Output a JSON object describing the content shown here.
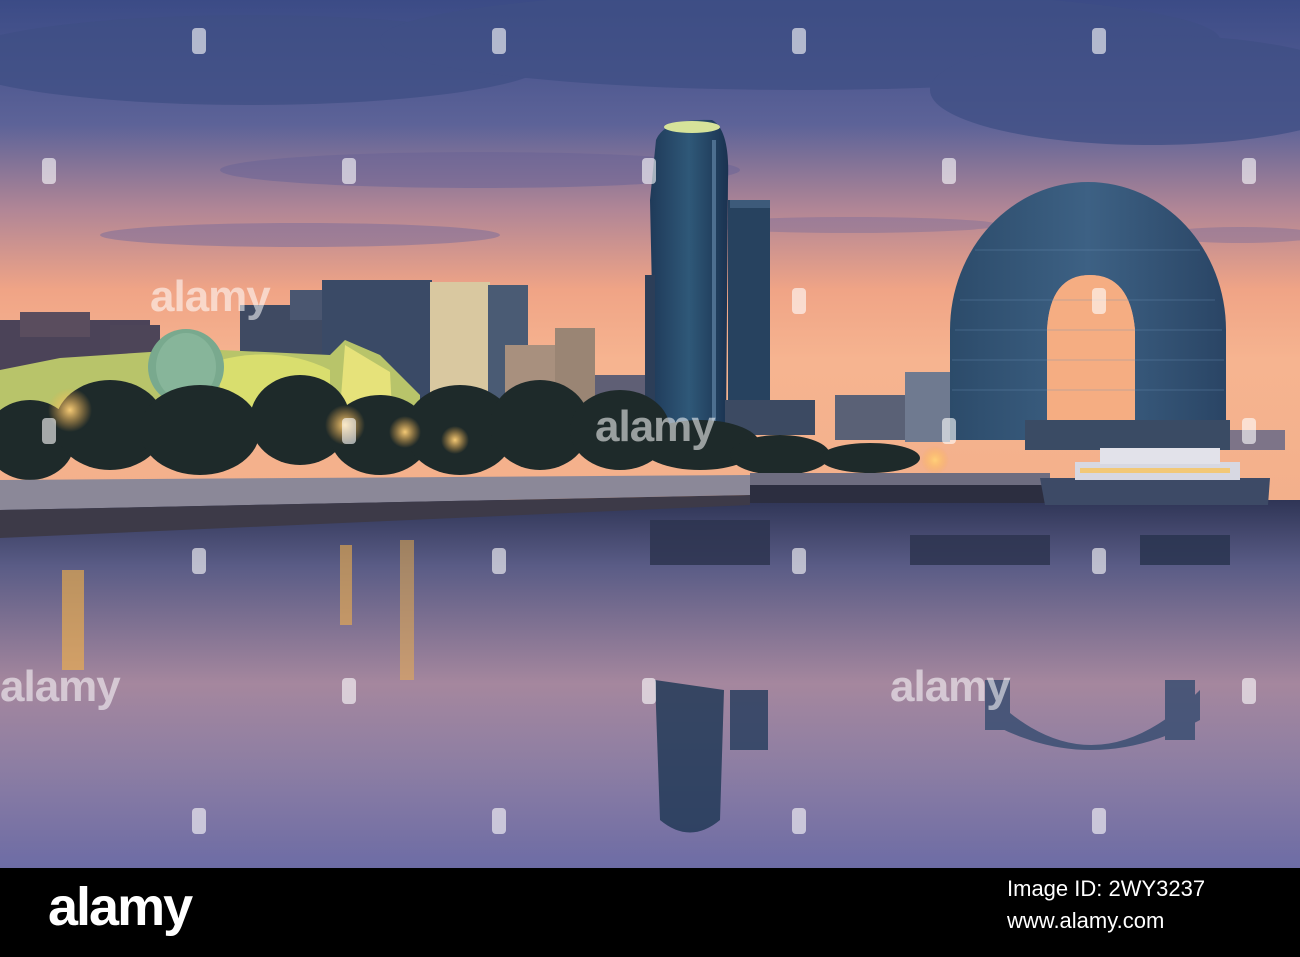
{
  "watermark": {
    "text": "alamy"
  },
  "footer": {
    "brand": "alamy",
    "image_id": "Image ID: 2WY3237",
    "site": "www.alamy.com"
  },
  "colors": {
    "sky_top": "#3d4f86",
    "sky_horizon": "#f0a486",
    "water": "#6b6a9a",
    "footer_bg": "#000000"
  }
}
